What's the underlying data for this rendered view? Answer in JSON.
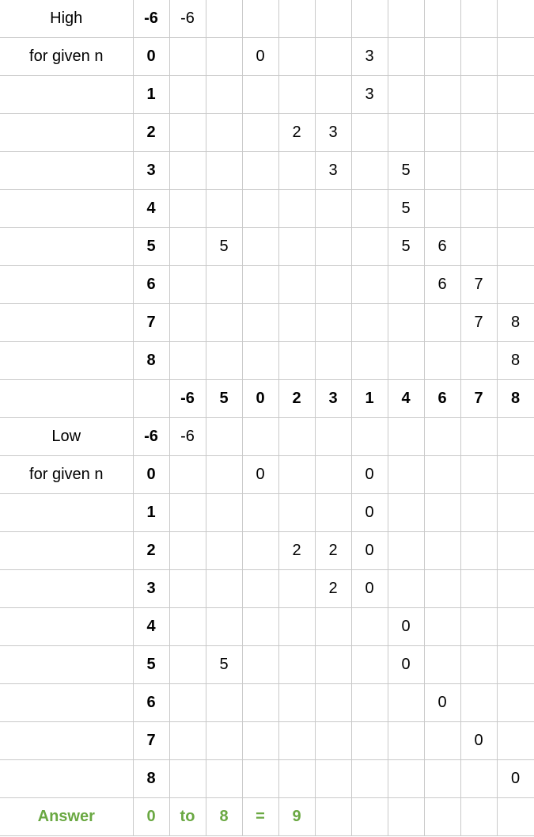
{
  "high_section": {
    "title": "High",
    "subtitle": "for given n",
    "rows": [
      {
        "n": "-6",
        "cells": [
          "-6",
          "",
          "",
          "",
          "",
          "",
          "",
          "",
          "",
          ""
        ]
      },
      {
        "n": "0",
        "cells": [
          "",
          "",
          "0",
          "",
          "",
          "3",
          "",
          "",
          "",
          ""
        ]
      },
      {
        "n": "1",
        "cells": [
          "",
          "",
          "",
          "",
          "",
          "3",
          "",
          "",
          "",
          ""
        ]
      },
      {
        "n": "2",
        "cells": [
          "",
          "",
          "",
          "2",
          "3",
          "",
          "",
          "",
          "",
          ""
        ]
      },
      {
        "n": "3",
        "cells": [
          "",
          "",
          "",
          "",
          "3",
          "",
          "5",
          "",
          "",
          ""
        ]
      },
      {
        "n": "4",
        "cells": [
          "",
          "",
          "",
          "",
          "",
          "",
          "5",
          "",
          "",
          ""
        ]
      },
      {
        "n": "5",
        "cells": [
          "",
          "5",
          "",
          "",
          "",
          "",
          "5",
          "6",
          "",
          ""
        ]
      },
      {
        "n": "6",
        "cells": [
          "",
          "",
          "",
          "",
          "",
          "",
          "",
          "6",
          "7",
          ""
        ]
      },
      {
        "n": "7",
        "cells": [
          "",
          "",
          "",
          "",
          "",
          "",
          "",
          "",
          "7",
          "8"
        ]
      },
      {
        "n": "8",
        "cells": [
          "",
          "",
          "",
          "",
          "",
          "",
          "",
          "",
          "",
          "8"
        ]
      }
    ]
  },
  "sequence_header": [
    "-6",
    "5",
    "0",
    "2",
    "3",
    "1",
    "4",
    "6",
    "7",
    "8"
  ],
  "low_section": {
    "title": "Low",
    "subtitle": "for given n",
    "rows": [
      {
        "n": "-6",
        "cells": [
          "-6",
          "",
          "",
          "",
          "",
          "",
          "",
          "",
          "",
          ""
        ]
      },
      {
        "n": "0",
        "cells": [
          "",
          "",
          "0",
          "",
          "",
          "0",
          "",
          "",
          "",
          ""
        ]
      },
      {
        "n": "1",
        "cells": [
          "",
          "",
          "",
          "",
          "",
          "0",
          "",
          "",
          "",
          ""
        ]
      },
      {
        "n": "2",
        "cells": [
          "",
          "",
          "",
          "2",
          "2",
          "0",
          "",
          "",
          "",
          ""
        ]
      },
      {
        "n": "3",
        "cells": [
          "",
          "",
          "",
          "",
          "2",
          "0",
          "",
          "",
          "",
          ""
        ]
      },
      {
        "n": "4",
        "cells": [
          "",
          "",
          "",
          "",
          "",
          "",
          "0",
          "",
          "",
          ""
        ]
      },
      {
        "n": "5",
        "cells": [
          "",
          "5",
          "",
          "",
          "",
          "",
          "0",
          "",
          "",
          ""
        ]
      },
      {
        "n": "6",
        "cells": [
          "",
          "",
          "",
          "",
          "",
          "",
          "",
          "0",
          "",
          ""
        ]
      },
      {
        "n": "7",
        "cells": [
          "",
          "",
          "",
          "",
          "",
          "",
          "",
          "",
          "0",
          ""
        ]
      },
      {
        "n": "8",
        "cells": [
          "",
          "",
          "",
          "",
          "",
          "",
          "",
          "",
          "",
          "0"
        ]
      }
    ]
  },
  "answer": {
    "label": "Answer",
    "from": "0",
    "to_word": "to",
    "to": "8",
    "equals": "=",
    "result": "9"
  },
  "colors": {
    "answer": "#6aa842",
    "grid": "#c9c9c9"
  }
}
